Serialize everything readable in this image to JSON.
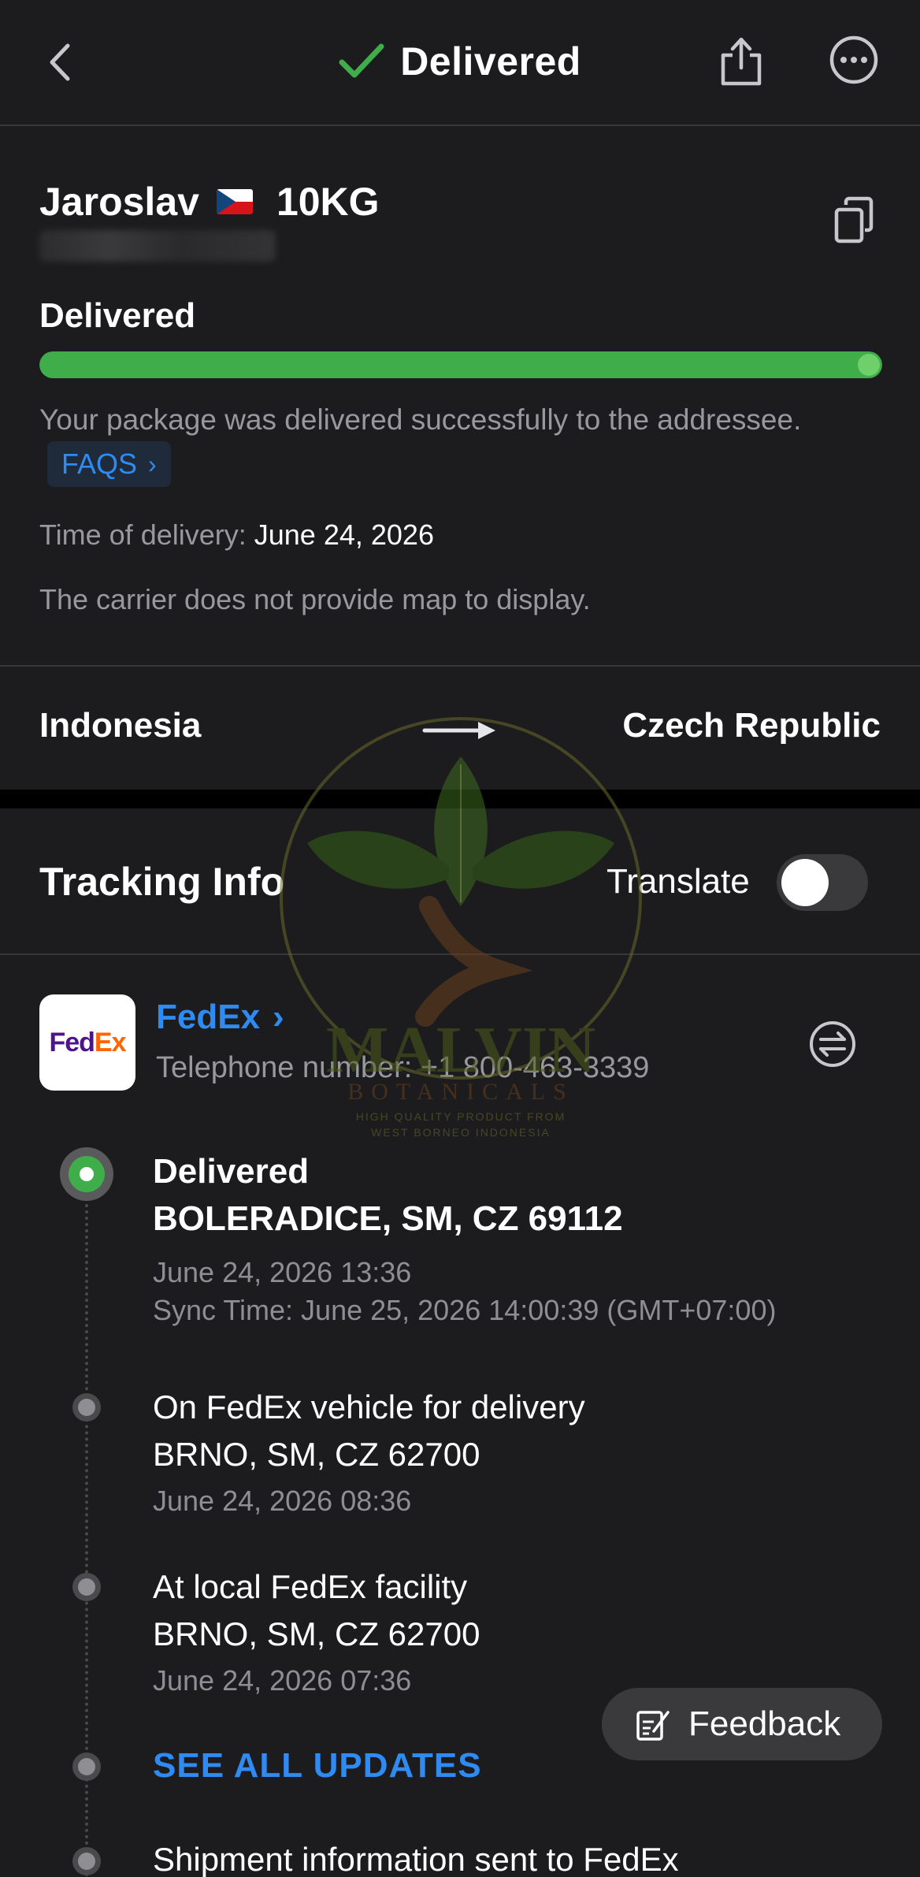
{
  "header": {
    "title": "Delivered"
  },
  "package": {
    "name": "Jaroslav",
    "weight": "10KG",
    "status_label": "Delivered",
    "progress": 1.0,
    "status_description": "Your package was delivered successfully to the addressee.",
    "faq_label": "FAQS",
    "time_label": "Time of delivery:",
    "time_value": "June 24, 2026",
    "map_note": "The carrier does not provide map to display."
  },
  "route": {
    "from": "Indonesia",
    "to": "Czech Republic"
  },
  "tracking": {
    "title": "Tracking Info",
    "translate_label": "Translate",
    "translate_on": false
  },
  "carrier": {
    "logo_fed": "Fed",
    "logo_ex": "Ex",
    "name": "FedEx",
    "phone": "Telephone number: +1 800-463-3339"
  },
  "events": [
    {
      "title": "Delivered",
      "location": "BOLERADICE, SM, CZ 69112",
      "time": "June 24, 2026 13:36",
      "sync": "Sync Time: June 25, 2026 14:00:39 (GMT+07:00)"
    },
    {
      "title": "On FedEx vehicle for delivery",
      "location": "BRNO, SM, CZ 62700",
      "time": "June 24, 2026 08:36"
    },
    {
      "title": "At local FedEx facility",
      "location": "BRNO, SM, CZ 62700",
      "time": "June 24, 2026 07:36"
    },
    {
      "title": "Shipment information sent to FedEx"
    }
  ],
  "see_all_label": "SEE ALL UPDATES",
  "feedback_label": "Feedback",
  "watermark": {
    "brand": "MALVIN",
    "sub": "BOTANICALS",
    "tagline_1": "HIGH QUALITY PRODUCT FROM",
    "tagline_2": "WEST BORNEO INDONESIA"
  },
  "colors": {
    "background": "#1c1c1e",
    "accent_green": "#3fae4a",
    "link_blue": "#2f8bf2",
    "secondary_text": "#98989d"
  }
}
